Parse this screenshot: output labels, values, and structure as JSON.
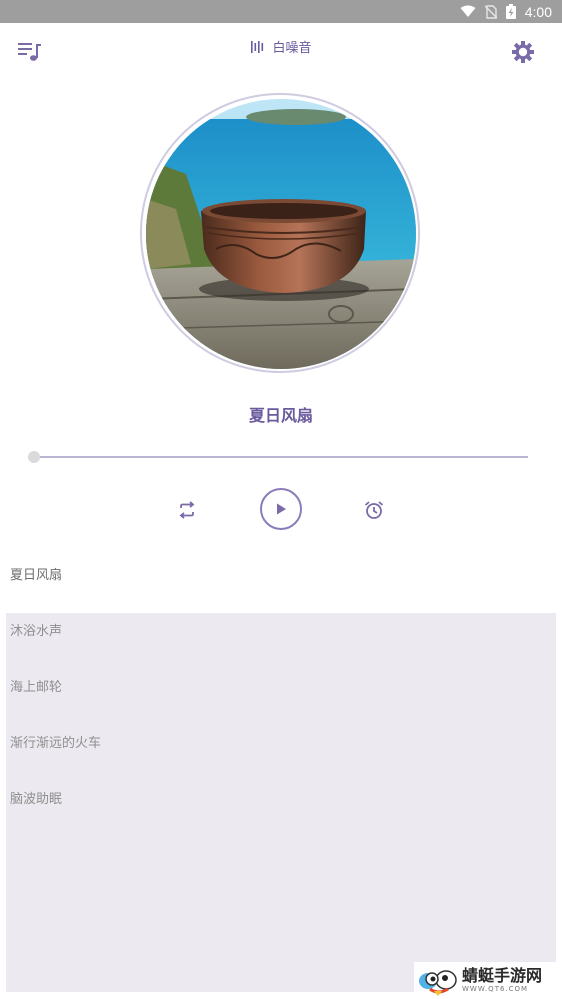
{
  "status_bar": {
    "time": "4:00",
    "icons": [
      "wifi-icon",
      "no-sim-icon",
      "battery-charging-icon"
    ]
  },
  "app_bar": {
    "title": "白噪音",
    "title_icon": "sound-bars-icon",
    "left_icon": "playlist-icon",
    "right_icon": "settings-gear-icon"
  },
  "player": {
    "cover_image": "singing-bowl-photo",
    "track_title": "夏日风扇",
    "progress": 0,
    "controls": {
      "repeat_icon": "repeat-icon",
      "play_icon": "play-icon",
      "alarm_icon": "alarm-clock-icon"
    }
  },
  "playlist": {
    "items": [
      {
        "label": "夏日风扇",
        "active": true
      },
      {
        "label": "沐浴水声",
        "active": false
      },
      {
        "label": "海上邮轮",
        "active": false
      },
      {
        "label": "渐行渐远的火车",
        "active": false
      },
      {
        "label": "脑波助眠",
        "active": false
      }
    ]
  },
  "watermark": {
    "brand": "蜻蜓手游网",
    "site": "WWW.QT6.COM"
  },
  "colors": {
    "accent": "#6a5a9e",
    "status_bar": "#9e9e9e",
    "list_background": "#eceaf0"
  }
}
